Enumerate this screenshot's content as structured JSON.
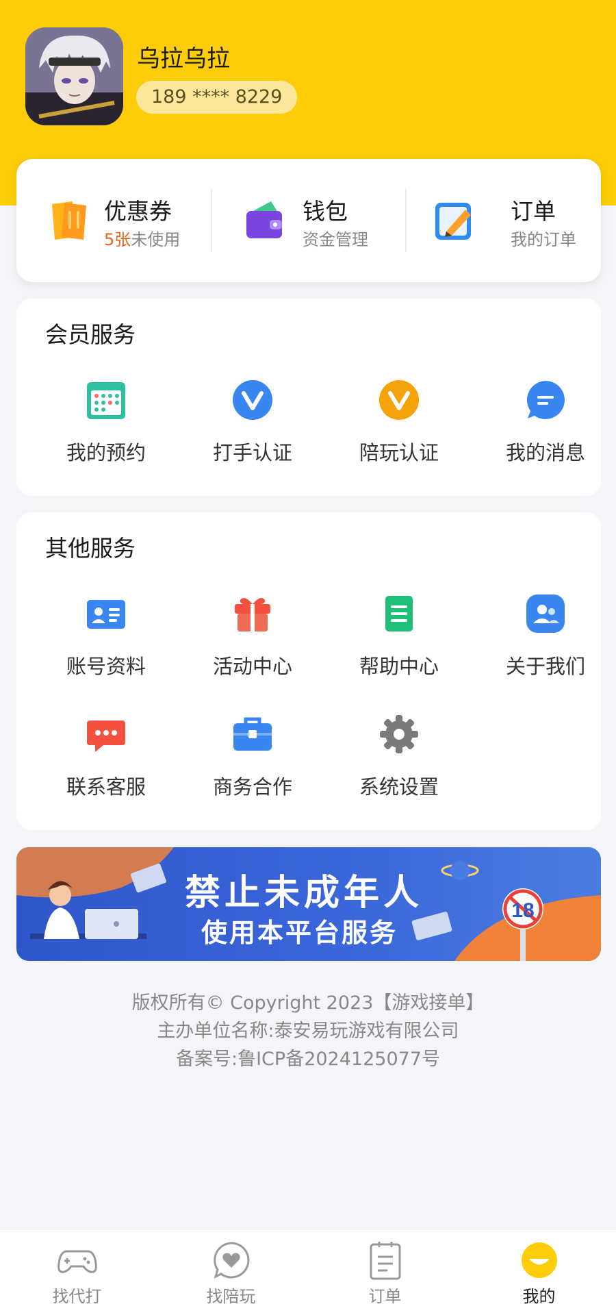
{
  "profile": {
    "name": "乌拉乌拉",
    "phone": "189 **** 8229"
  },
  "quick": [
    {
      "title": "优惠券",
      "count": "5张",
      "sub": "未使用",
      "icon": "coupon-icon"
    },
    {
      "title": "钱包",
      "sub": "资金管理",
      "icon": "wallet-icon"
    },
    {
      "title": "订单",
      "sub": "我的订单",
      "icon": "order-edit-icon"
    }
  ],
  "member": {
    "title": "会员服务",
    "items": [
      {
        "label": "我的预约",
        "icon": "calendar-icon"
      },
      {
        "label": "打手认证",
        "icon": "verified-v-icon"
      },
      {
        "label": "陪玩认证",
        "icon": "verified-v-icon"
      },
      {
        "label": "我的消息",
        "icon": "message-icon"
      }
    ]
  },
  "other": {
    "title": "其他服务",
    "items": [
      {
        "label": "账号资料",
        "icon": "id-card-icon"
      },
      {
        "label": "活动中心",
        "icon": "gift-icon"
      },
      {
        "label": "帮助中心",
        "icon": "document-icon"
      },
      {
        "label": "关于我们",
        "icon": "people-icon"
      },
      {
        "label": "联系客服",
        "icon": "chat-icon"
      },
      {
        "label": "商务合作",
        "icon": "briefcase-icon"
      },
      {
        "label": "系统设置",
        "icon": "gear-icon"
      }
    ]
  },
  "banner": {
    "line1": "禁止未成年人",
    "line2": "使用本平台服务",
    "badge": "18"
  },
  "footer": {
    "copyright": "版权所有© Copyright 2023【游戏接单】",
    "company": "主办单位名称:泰安易玩游戏有限公司",
    "icp": "备案号:鲁ICP备2024125077号"
  },
  "tabs": [
    {
      "label": "找代打",
      "icon": "gamepad-icon",
      "active": false
    },
    {
      "label": "找陪玩",
      "icon": "heart-chat-icon",
      "active": false
    },
    {
      "label": "订单",
      "icon": "clipboard-icon",
      "active": false
    },
    {
      "label": "我的",
      "icon": "smiley-icon",
      "active": true
    }
  ],
  "colors": {
    "brand": "#ffcc0a",
    "accent": "#e0651d",
    "background": "#f4f5f9"
  }
}
